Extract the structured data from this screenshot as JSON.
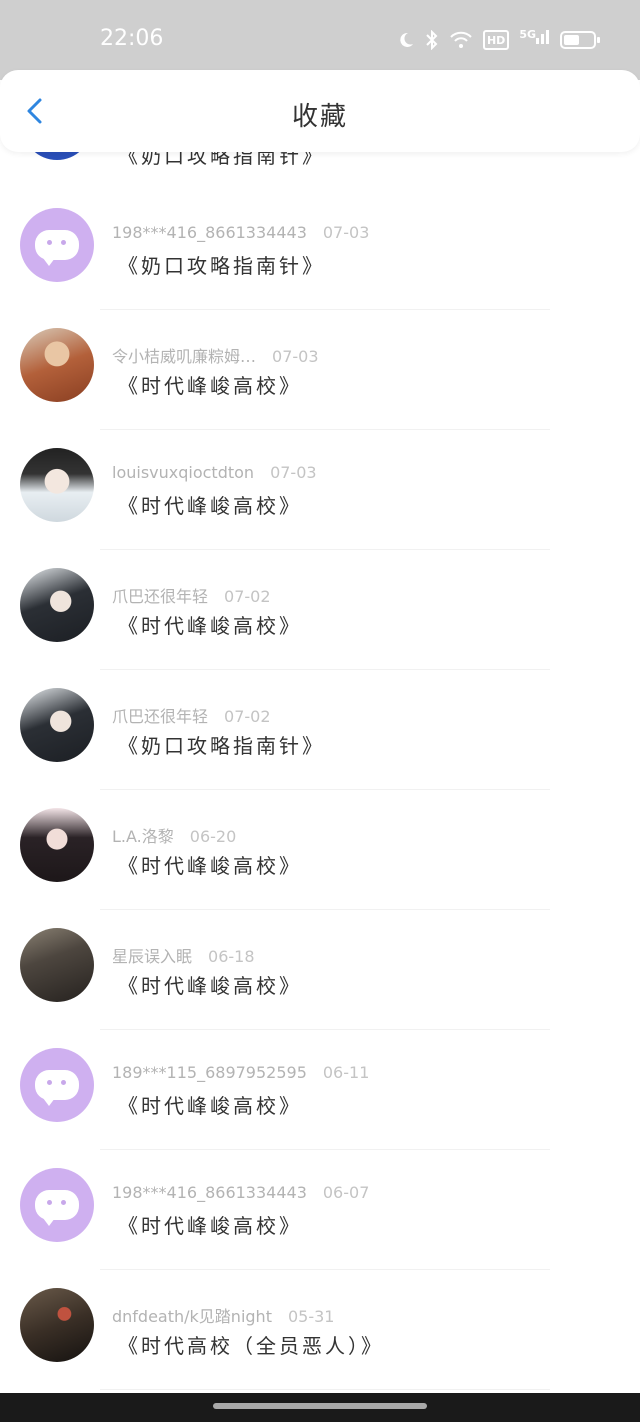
{
  "status_bar": {
    "time": "22:06",
    "icons": [
      "moon-icon",
      "bluetooth-icon",
      "wifi-icon",
      "hd-icon",
      "5g-signal-icon",
      "battery-icon"
    ],
    "hd_label": "HD",
    "network_label": "5G",
    "battery_level": 0.55
  },
  "header": {
    "title": "收藏",
    "back_icon": "chevron-left-icon",
    "accent_color": "#2f86e0"
  },
  "partial_top_item": {
    "work": "《奶口攻略指南针》"
  },
  "items": [
    {
      "user": "198***416_8661334443",
      "date": "07-03",
      "work": "《奶口攻略指南针》",
      "avatar": "bot"
    },
    {
      "user": "令小桔威叽廉粽姆…",
      "date": "07-03",
      "work": "《时代峰峻高校》",
      "avatar": "photo-girl-orange"
    },
    {
      "user": "louisvuxqioctdton",
      "date": "07-03",
      "work": "《时代峰峻高校》",
      "avatar": "photo-anime-boy"
    },
    {
      "user": "爪巴还很年轻",
      "date": "07-02",
      "work": "《时代峰峻高校》",
      "avatar": "photo-anime-boy-dark"
    },
    {
      "user": "爪巴还很年轻",
      "date": "07-02",
      "work": "《奶口攻略指南针》",
      "avatar": "photo-anime-boy-dark"
    },
    {
      "user": "L.A.洛黎",
      "date": "06-20",
      "work": "《时代峰峻高校》",
      "avatar": "photo-girl-dark-hair"
    },
    {
      "user": "星辰误入眠",
      "date": "06-18",
      "work": "《时代峰峻高校》",
      "avatar": "photo-mirror-selfie"
    },
    {
      "user": "189***115_6897952595",
      "date": "06-11",
      "work": "《时代峰峻高校》",
      "avatar": "bot"
    },
    {
      "user": "198***416_8661334443",
      "date": "06-07",
      "work": "《时代峰峻高校》",
      "avatar": "bot"
    },
    {
      "user": "dnfdeath/k见踏night",
      "date": "05-31",
      "work": "《时代高校（全员恶人）》",
      "avatar": "photo-dark-scene"
    }
  ]
}
